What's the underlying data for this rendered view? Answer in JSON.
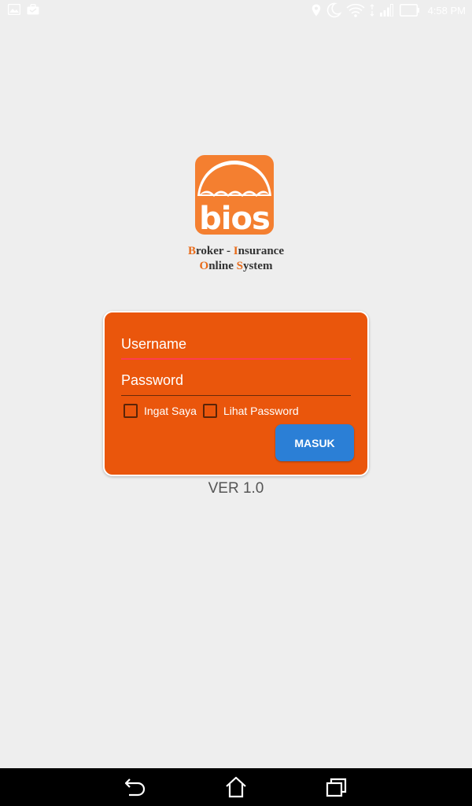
{
  "status_bar": {
    "time": "4:58 PM",
    "left_icons": [
      "gallery-icon",
      "briefcase-icon"
    ],
    "right_icons": [
      "location-icon",
      "moon-icon",
      "wifi-icon",
      "signal-icon",
      "battery-icon"
    ]
  },
  "logo": {
    "text": "bios"
  },
  "tagline": {
    "line1": {
      "a": "B",
      "b": "roker - ",
      "c": "I",
      "d": "nsurance"
    },
    "line2": {
      "a": "O",
      "b": "nline ",
      "c": "S",
      "d": "ystem"
    }
  },
  "form": {
    "username_placeholder": "Username",
    "password_placeholder": "Password",
    "remember_label": "Ingat Saya",
    "show_password_label": "Lihat Password",
    "submit_label": "MASUK"
  },
  "version": "VER 1.0",
  "colors": {
    "accent_orange": "#ea560c",
    "logo_orange": "#f47f30",
    "button_blue": "#2b7fd6",
    "focus_underline": "#ff3d50"
  },
  "nav_bar": {
    "icons": [
      "back-icon",
      "home-icon",
      "recent-apps-icon"
    ]
  }
}
